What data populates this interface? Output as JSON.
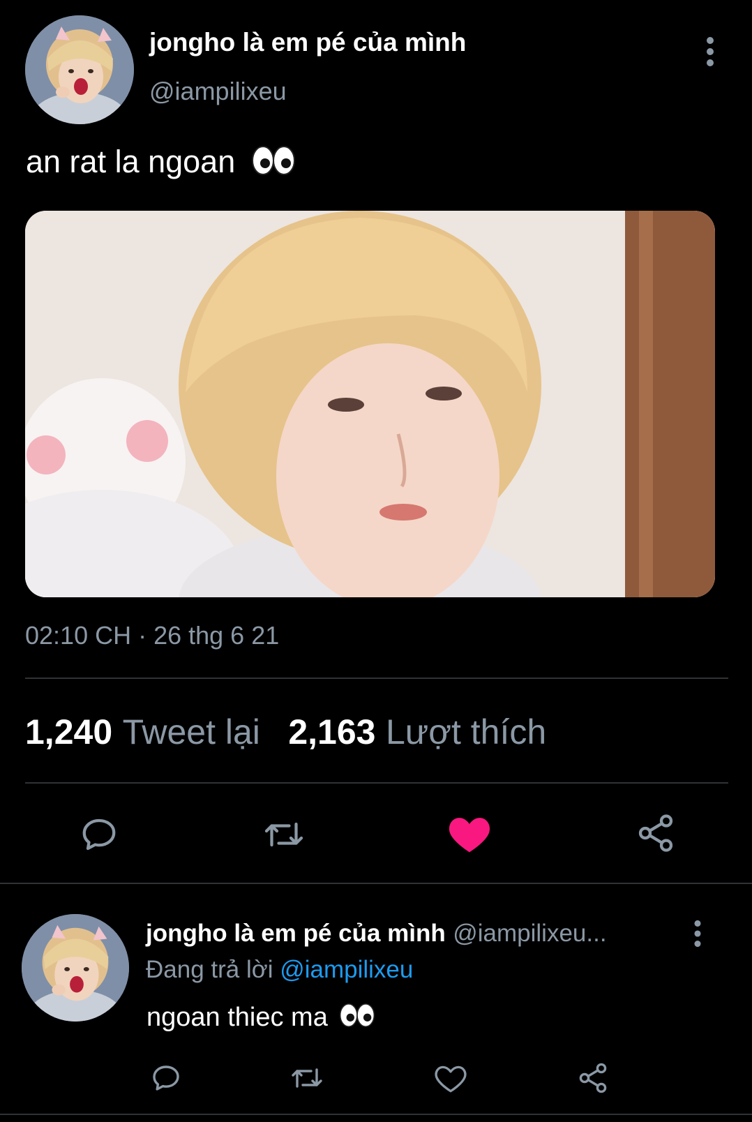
{
  "tweet": {
    "display_name": "jongho là em pé của mình",
    "handle": "@iampilixeu",
    "text": "an rat la ngoan",
    "emoji": "eyes-emoji",
    "timestamp": "02:10 CH · 26 thg 6 21",
    "retweets_count": "1,240",
    "retweets_label": "Tweet lại",
    "likes_count": "2,163",
    "likes_label": "Lượt thích",
    "liked": true,
    "actions": [
      "reply-icon",
      "retweet-icon",
      "heart-icon",
      "share-icon"
    ]
  },
  "reply": {
    "display_name": "jongho là em pé của mình",
    "handle": "@iampilixeu...",
    "replying_prefix": "Đang trả lời",
    "replying_mention": "@iampilixeu",
    "text": "ngoan thiec ma",
    "emoji": "eyes-emoji",
    "liked": false,
    "actions": [
      "reply-icon",
      "retweet-icon",
      "heart-icon",
      "share-icon"
    ]
  },
  "colors": {
    "background": "#000000",
    "text_primary": "#ffffff",
    "text_secondary": "#8b98a5",
    "mention": "#1d9bf0",
    "like_active": "#f91880",
    "divider": "#2f3336"
  }
}
